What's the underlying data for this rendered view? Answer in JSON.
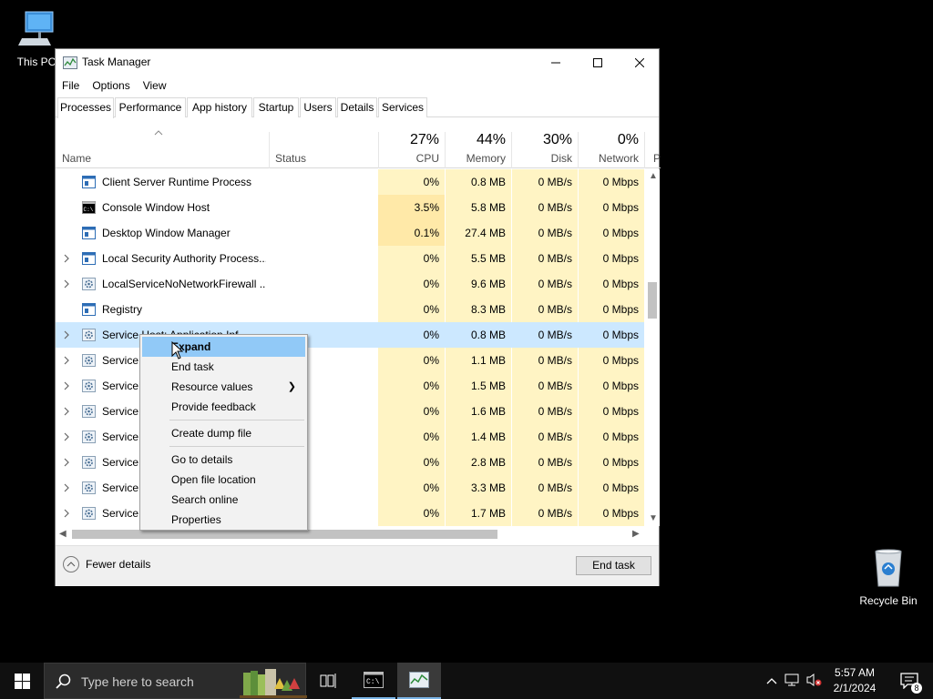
{
  "desktop": {
    "this_pc_label": "This PC",
    "recycle_bin_label": "Recycle Bin"
  },
  "window": {
    "title": "Task Manager",
    "menu": [
      "File",
      "Options",
      "View"
    ],
    "tabs": [
      "Processes",
      "Performance",
      "App history",
      "Startup",
      "Users",
      "Details",
      "Services"
    ],
    "active_tab": "Processes"
  },
  "columns": {
    "name": "Name",
    "status": "Status",
    "cpu": {
      "pct": "27%",
      "label": "CPU"
    },
    "memory": {
      "pct": "44%",
      "label": "Memory"
    },
    "disk": {
      "pct": "30%",
      "label": "Disk"
    },
    "network": {
      "pct": "0%",
      "label": "Network"
    },
    "power_partial": "P"
  },
  "rows": [
    {
      "name": "Client Server Runtime Process",
      "cpu": "0%",
      "mem": "0.8 MB",
      "disk": "0 MB/s",
      "net": "0 Mbps",
      "expandable": false,
      "icon": "window-icon"
    },
    {
      "name": "Console Window Host",
      "cpu": "3.5%",
      "mem": "5.8 MB",
      "disk": "0 MB/s",
      "net": "0 Mbps",
      "expandable": false,
      "icon": "console-icon"
    },
    {
      "name": "Desktop Window Manager",
      "cpu": "0.1%",
      "mem": "27.4 MB",
      "disk": "0 MB/s",
      "net": "0 Mbps",
      "expandable": false,
      "icon": "window-icon"
    },
    {
      "name": "Local Security Authority Process...",
      "cpu": "0%",
      "mem": "5.5 MB",
      "disk": "0 MB/s",
      "net": "0 Mbps",
      "expandable": true,
      "icon": "window-icon"
    },
    {
      "name": "LocalServiceNoNetworkFirewall ...",
      "cpu": "0%",
      "mem": "9.6 MB",
      "disk": "0 MB/s",
      "net": "0 Mbps",
      "expandable": true,
      "icon": "gear-icon"
    },
    {
      "name": "Registry",
      "cpu": "0%",
      "mem": "8.3 MB",
      "disk": "0 MB/s",
      "net": "0 Mbps",
      "expandable": false,
      "icon": "window-icon"
    },
    {
      "name": "Service Host: Application Inf...",
      "cpu": "0%",
      "mem": "0.8 MB",
      "disk": "0 MB/s",
      "net": "0 Mbps",
      "expandable": true,
      "icon": "gear-icon",
      "selected": true
    },
    {
      "name": "Service Host",
      "cpu": "0%",
      "mem": "1.1 MB",
      "disk": "0 MB/s",
      "net": "0 Mbps",
      "expandable": true,
      "icon": "gear-icon"
    },
    {
      "name": "Service Host",
      "cpu": "0%",
      "mem": "1.5 MB",
      "disk": "0 MB/s",
      "net": "0 Mbps",
      "expandable": true,
      "icon": "gear-icon"
    },
    {
      "name": "Service Host",
      "cpu": "0%",
      "mem": "1.6 MB",
      "disk": "0 MB/s",
      "net": "0 Mbps",
      "expandable": true,
      "icon": "gear-icon"
    },
    {
      "name": "Service Host",
      "cpu": "0%",
      "mem": "1.4 MB",
      "disk": "0 MB/s",
      "net": "0 Mbps",
      "expandable": true,
      "icon": "gear-icon"
    },
    {
      "name": "Service Host",
      "cpu": "0%",
      "mem": "2.8 MB",
      "disk": "0 MB/s",
      "net": "0 Mbps",
      "expandable": true,
      "icon": "gear-icon"
    },
    {
      "name": "Service Host",
      "cpu": "0%",
      "mem": "3.3 MB",
      "disk": "0 MB/s",
      "net": "0 Mbps",
      "expandable": true,
      "icon": "gear-icon"
    },
    {
      "name": "Service Host",
      "cpu": "0%",
      "mem": "1.7 MB",
      "disk": "0 MB/s",
      "net": "0 Mbps",
      "expandable": true,
      "icon": "gear-icon"
    }
  ],
  "context_menu": {
    "groups": [
      [
        "Expand",
        "End task",
        "Resource values",
        "Provide feedback"
      ],
      [
        "Create dump file"
      ],
      [
        "Go to details",
        "Open file location",
        "Search online",
        "Properties"
      ]
    ],
    "highlighted": "Expand",
    "submenu_item": "Resource values"
  },
  "footer": {
    "fewer_details": "Fewer details",
    "end_task": "End task"
  },
  "taskbar": {
    "search_placeholder": "Type here to search",
    "time": "5:57 AM",
    "date": "2/1/2024",
    "notification_count": "8"
  }
}
